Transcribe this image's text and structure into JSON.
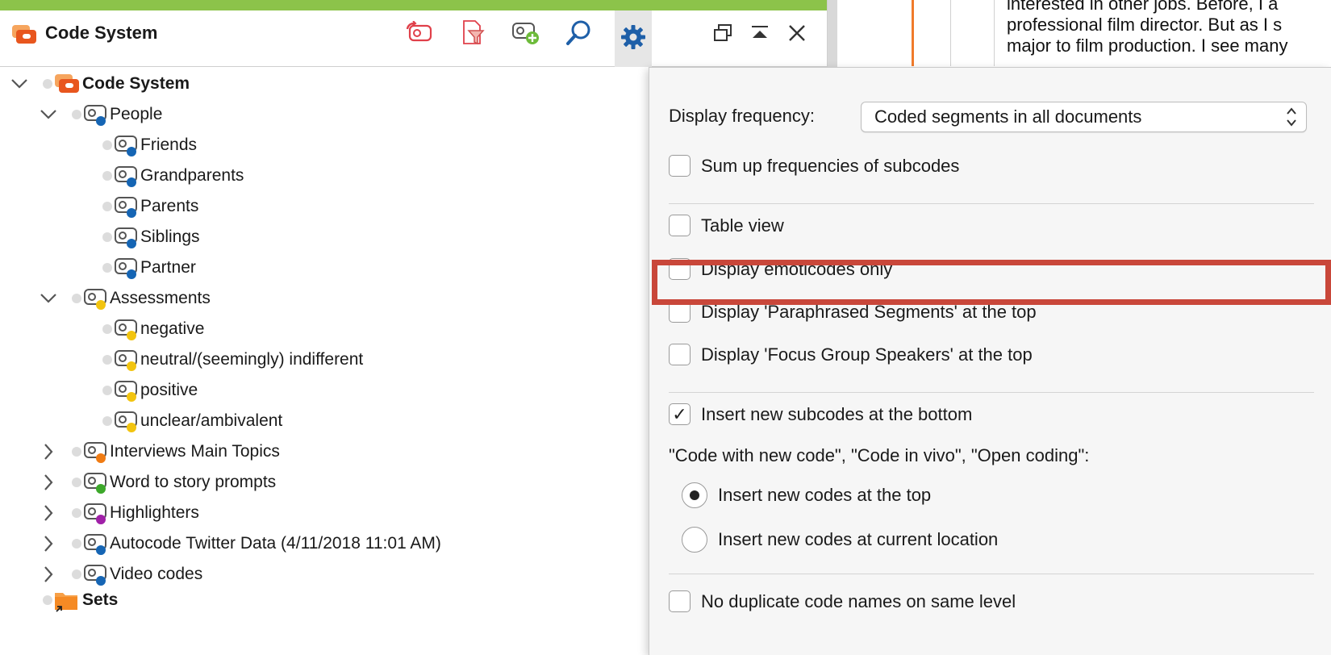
{
  "panel": {
    "title": "Code System"
  },
  "toolbar": {
    "icons": [
      "reset-code-icon",
      "filter-document-icon",
      "new-code-icon",
      "search-icon",
      "settings-gear-icon",
      "undock-window-icon",
      "collapse-up-icon",
      "close-icon"
    ]
  },
  "tree": {
    "root": {
      "label": "Code System"
    },
    "items": [
      {
        "label": "People",
        "color": "#1565b4",
        "expanded": true
      },
      {
        "label": "Friends",
        "color": "#1565b4"
      },
      {
        "label": "Grandparents",
        "color": "#1565b4"
      },
      {
        "label": "Parents",
        "color": "#1565b4"
      },
      {
        "label": "Siblings",
        "color": "#1565b4"
      },
      {
        "label": "Partner",
        "color": "#1565b4"
      },
      {
        "label": "Assessments",
        "color": "#f2c40f",
        "expanded": true
      },
      {
        "label": "negative",
        "color": "#f2c40f"
      },
      {
        "label": "neutral/(seemingly) indifferent",
        "color": "#f2c40f"
      },
      {
        "label": "positive",
        "color": "#f2c40f"
      },
      {
        "label": "unclear/ambivalent",
        "color": "#f2c40f"
      },
      {
        "label": "Interviews Main Topics",
        "color": "#f07b12",
        "expanded": false
      },
      {
        "label": "Word to story prompts",
        "color": "#3ca82a",
        "expanded": false
      },
      {
        "label": "Highlighters",
        "color": "#a020a8",
        "expanded": false
      },
      {
        "label": "Autocode Twitter Data (4/11/2018 11:01 AM)",
        "color": "#1565b4",
        "expanded": false
      },
      {
        "label": "Video codes",
        "color": "#1565b4",
        "expanded": false
      }
    ],
    "sets": {
      "label": "Sets"
    }
  },
  "document": {
    "lines": [
      "interested in other jobs. Before, I a",
      "professional film director. But as I s",
      "major to film production. I see many"
    ]
  },
  "settings_menu": {
    "display_frequency_label": "Display frequency:",
    "display_frequency_value": "Coded segments in all documents",
    "sum_up": {
      "label": "Sum up frequencies of subcodes",
      "checked": false
    },
    "table_view": {
      "label": "Table view",
      "checked": false
    },
    "emoticodes": {
      "label": "Display emoticodes only",
      "checked": false
    },
    "paraphrased": {
      "label": "Display 'Paraphrased Segments' at the top",
      "checked": false
    },
    "focus_group": {
      "label": "Display 'Focus Group Speakers' at the top",
      "checked": false
    },
    "insert_subcodes": {
      "label": "Insert new subcodes at the bottom",
      "checked": true,
      "mark": "✓"
    },
    "new_code_heading": "\"Code with new code\", \"Code in vivo\", \"Open coding\":",
    "insert_top": {
      "label": "Insert new codes at the top",
      "selected": true
    },
    "insert_current": {
      "label": "Insert new codes at current location",
      "selected": false
    },
    "no_duplicates": {
      "label": "No duplicate code names on same level",
      "checked": false
    }
  },
  "colors": {
    "accent_green": "#8cc34a",
    "highlight_red": "#c9473a",
    "app_orange": "#f07b2b",
    "icon_blue": "#1565b4"
  }
}
